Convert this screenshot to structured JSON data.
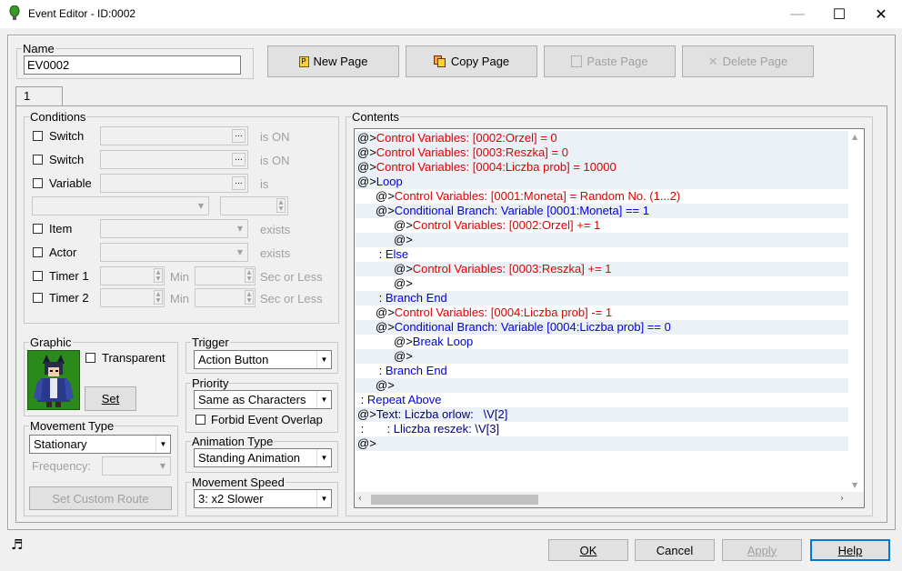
{
  "window": {
    "title": "Event Editor - ID:0002",
    "minimize": "—",
    "maximize": "☐",
    "close": "✕"
  },
  "name": {
    "label": "Name",
    "value": "EV0002"
  },
  "page_buttons": {
    "new": "New Page",
    "copy": "Copy Page",
    "paste": "Paste Page",
    "delete": "Delete Page"
  },
  "tabs": [
    "1"
  ],
  "conditions": {
    "label": "Conditions",
    "switch1": "Switch",
    "switch1_suffix": "is ON",
    "switch2": "Switch",
    "switch2_suffix": "is ON",
    "variable": "Variable",
    "variable_suffix": "is",
    "item": "Item",
    "item_suffix": "exists",
    "actor": "Actor",
    "actor_suffix": "exists",
    "timer1": "Timer 1",
    "timer2": "Timer 2",
    "min": "Min",
    "sec_or_less": "Sec or Less"
  },
  "graphic": {
    "label": "Graphic",
    "transparent": "Transparent",
    "set": "Set"
  },
  "trigger": {
    "label": "Trigger",
    "value": "Action Button"
  },
  "priority": {
    "label": "Priority",
    "value": "Same as Characters",
    "forbid": "Forbid Event Overlap"
  },
  "movement_type": {
    "label": "Movement Type",
    "value": "Stationary",
    "frequency": "Frequency:",
    "custom_route": "Set Custom Route"
  },
  "animation_type": {
    "label": "Animation Type",
    "value": "Standing Animation"
  },
  "movement_speed": {
    "label": "Movement Speed",
    "value": "3: x2 Slower"
  },
  "contents": {
    "label": "Contents",
    "lines": [
      {
        "prefix": "@>",
        "text": "Control Variables: [0002:Orzel] = 0",
        "color": "#e00000",
        "indent": 0,
        "highlight": true
      },
      {
        "prefix": "@>",
        "text": "Control Variables: [0003:Reszka] = 0",
        "color": "#e00000",
        "indent": 0,
        "highlight": true
      },
      {
        "prefix": "@>",
        "text": "Control Variables: [0004:Liczba prob] = 10000",
        "color": "#e00000",
        "indent": 0,
        "highlight": true
      },
      {
        "prefix": "@>",
        "text": "Loop",
        "color": "#0000e0",
        "indent": 0,
        "highlight": true
      },
      {
        "prefix": "@>",
        "text": "Control Variables: [0001:Moneta] = Random No. (1...2)",
        "color": "#e00000",
        "indent": 1,
        "highlight": false
      },
      {
        "prefix": "@>",
        "text": "Conditional Branch: Variable [0001:Moneta] == 1",
        "color": "#0000e0",
        "indent": 1,
        "highlight": true
      },
      {
        "prefix": "@>",
        "text": "Control Variables: [0002:Orzel] += 1",
        "color": "#e00000",
        "indent": 2,
        "highlight": false
      },
      {
        "prefix": "@>",
        "text": "",
        "color": "#000000",
        "indent": 2,
        "highlight": true
      },
      {
        "prefix": " : ",
        "text": "Else",
        "color": "#0000e0",
        "indent": 1,
        "highlight": false
      },
      {
        "prefix": "@>",
        "text": "Control Variables: [0003:Reszka] += 1",
        "color": "#e00000",
        "indent": 2,
        "highlight": true
      },
      {
        "prefix": "@>",
        "text": "",
        "color": "#000000",
        "indent": 2,
        "highlight": false
      },
      {
        "prefix": " : ",
        "text": "Branch End",
        "color": "#0000e0",
        "indent": 1,
        "highlight": true
      },
      {
        "prefix": "@>",
        "text": "Control Variables: [0004:Liczba prob] -= 1",
        "color": "#e00000",
        "indent": 1,
        "highlight": false
      },
      {
        "prefix": "@>",
        "text": "Conditional Branch: Variable [0004:Liczba prob] == 0",
        "color": "#0000e0",
        "indent": 1,
        "highlight": true
      },
      {
        "prefix": "@>",
        "text": "Break Loop",
        "color": "#0000e0",
        "indent": 2,
        "highlight": false
      },
      {
        "prefix": "@>",
        "text": "",
        "color": "#000000",
        "indent": 2,
        "highlight": true
      },
      {
        "prefix": " : ",
        "text": "Branch End",
        "color": "#0000e0",
        "indent": 1,
        "highlight": false
      },
      {
        "prefix": "@>",
        "text": "",
        "color": "#000000",
        "indent": 1,
        "highlight": true
      },
      {
        "prefix": " : ",
        "text": "Repeat Above",
        "color": "#0000e0",
        "indent": 0,
        "highlight": false
      },
      {
        "prefix": "@>",
        "text": "Text: Liczba orlow:   \\V[2]",
        "color": "#000080",
        "indent": 0,
        "highlight": true
      },
      {
        "prefix": " : ",
        "text": "      : Lliczba reszek: \\V[3]",
        "color": "#000080",
        "indent": 0,
        "highlight": false
      },
      {
        "prefix": "@>",
        "text": "",
        "color": "#000000",
        "indent": 0,
        "highlight": true
      }
    ]
  },
  "footer": {
    "ok": "OK",
    "cancel": "Cancel",
    "apply": "Apply",
    "help": "Help"
  },
  "colors": {
    "highlight_row": "#ebf1f6",
    "command_red": "#e00000",
    "command_blue": "#0000e0",
    "text_navy": "#000080",
    "sprite_bg": "#2a8a1a"
  }
}
